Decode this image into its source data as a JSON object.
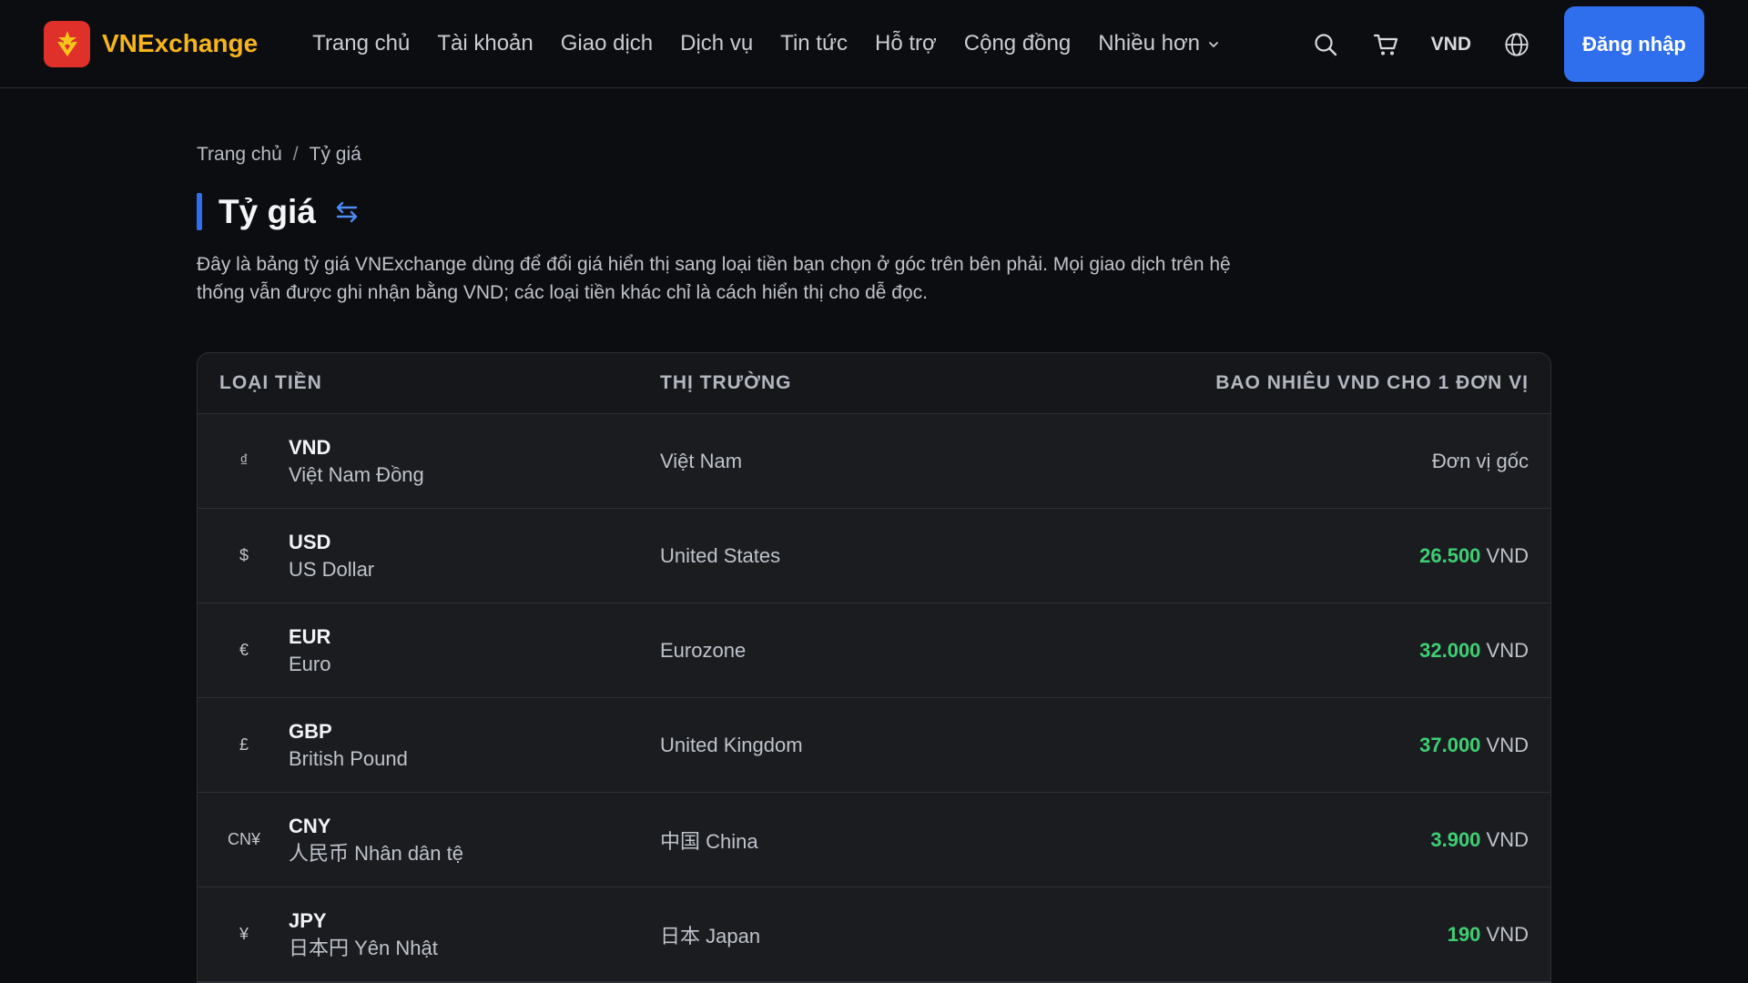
{
  "header": {
    "brand": "VNExchange",
    "nav": [
      {
        "label": "Trang chủ"
      },
      {
        "label": "Tài khoản"
      },
      {
        "label": "Giao dịch"
      },
      {
        "label": "Dịch vụ"
      },
      {
        "label": "Tin tức"
      },
      {
        "label": "Hỗ trợ"
      },
      {
        "label": "Cộng đồng"
      }
    ],
    "more_label": "Nhiều hơn",
    "currency": "VND",
    "login_label": "Đăng nhập",
    "icons": [
      "search-icon",
      "cart-icon",
      "globe-icon",
      "chevron-down-icon"
    ]
  },
  "breadcrumb": {
    "home": "Trang chủ",
    "separator": "/",
    "current": "Tỷ giá"
  },
  "page": {
    "title": "Tỷ giá",
    "title_icon": "swap-arrows-icon",
    "description": "Đây là bảng tỷ giá VNExchange dùng để đổi giá hiển thị sang loại tiền bạn chọn ở góc trên bên phải. Mọi giao dịch trên hệ thống vẫn được ghi nhận bằng VND; các loại tiền khác chỉ là cách hiển thị cho dễ đọc."
  },
  "table": {
    "headers": {
      "currency": "LOẠI TIỀN",
      "market": "THỊ TRƯỜNG",
      "rate": "BAO NHIÊU VND CHO 1 ĐƠN VỊ"
    },
    "rows": [
      {
        "symbol": "₫",
        "code": "VND",
        "name": "Việt Nam Đồng",
        "market": "Việt Nam",
        "base_label": "Đơn vị gốc"
      },
      {
        "symbol": "$",
        "code": "USD",
        "name": "US Dollar",
        "market": "United States",
        "value": "26.500",
        "unit": "VND"
      },
      {
        "symbol": "€",
        "code": "EUR",
        "name": "Euro",
        "market": "Eurozone",
        "value": "32.000",
        "unit": "VND"
      },
      {
        "symbol": "£",
        "code": "GBP",
        "name": "British Pound",
        "market": "United Kingdom",
        "value": "37.000",
        "unit": "VND"
      },
      {
        "symbol": "CN¥",
        "code": "CNY",
        "name": "人民币 Nhân dân tệ",
        "market": "中国 China",
        "value": "3.900",
        "unit": "VND"
      },
      {
        "symbol": "¥",
        "code": "JPY",
        "name": "日本円 Yên Nhật",
        "market": "日本 Japan",
        "value": "190",
        "unit": "VND"
      }
    ]
  },
  "colors": {
    "accent": "#2f6fed",
    "brand_text": "#f5b51b",
    "logo_bg": "#e0302a",
    "rate_value": "#3ecf74",
    "background": "#0c0d10"
  }
}
